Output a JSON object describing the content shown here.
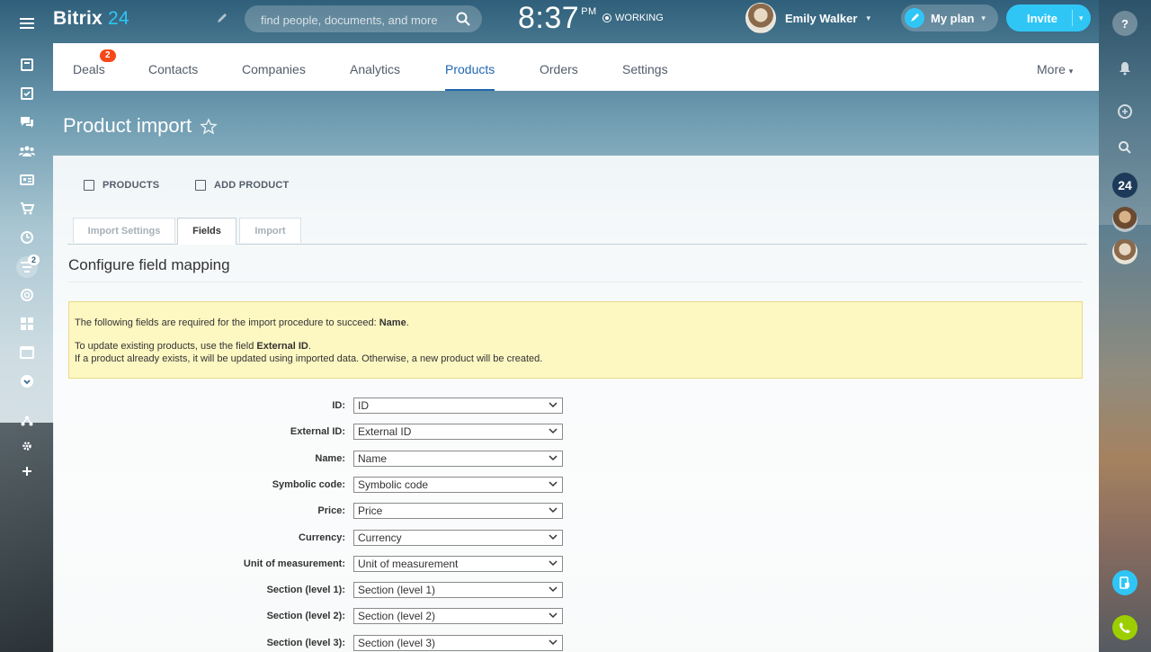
{
  "app": {
    "logo_text": "Bitrix",
    "logo_num": "24"
  },
  "header": {
    "search_placeholder": "find people, documents, and more",
    "time": "8:37",
    "ampm": "PM",
    "status": "WORKING",
    "user_name": "Emily Walker",
    "myplan_label": "My plan",
    "invite_label": "Invite"
  },
  "left_sidebar": {
    "badge": "2"
  },
  "nav": {
    "deals_badge": "2",
    "tabs": [
      {
        "label": "Deals"
      },
      {
        "label": "Contacts"
      },
      {
        "label": "Companies"
      },
      {
        "label": "Analytics"
      },
      {
        "label": "Products"
      },
      {
        "label": "Orders"
      },
      {
        "label": "Settings"
      }
    ],
    "more_label": "More"
  },
  "page": {
    "title": "Product import"
  },
  "toolbar": {
    "products_label": "PRODUCTS",
    "add_product_label": "ADD PRODUCT"
  },
  "import_tabs": [
    {
      "label": "Import Settings"
    },
    {
      "label": "Fields"
    },
    {
      "label": "Import"
    }
  ],
  "section": {
    "title": "Configure field mapping"
  },
  "notice": {
    "line1_prefix": "The following fields are required for the import procedure to succeed: ",
    "line1_bold": "Name",
    "line1_suffix": ".",
    "line2_prefix": "To update existing products, use the field ",
    "line2_bold": "External ID",
    "line2_suffix": ".",
    "line3": "If a product already exists, it will be updated using imported data. Otherwise, a new product will be created."
  },
  "right_bar": {
    "b24_label": "24"
  },
  "fields": [
    {
      "label": "ID:",
      "value": "ID"
    },
    {
      "label": "External ID:",
      "value": "External ID"
    },
    {
      "label": "Name:",
      "value": "Name"
    },
    {
      "label": "Symbolic code:",
      "value": "Symbolic code"
    },
    {
      "label": "Price:",
      "value": "Price"
    },
    {
      "label": "Currency:",
      "value": "Currency"
    },
    {
      "label": "Unit of measurement:",
      "value": "Unit of measurement"
    },
    {
      "label": "Section (level 1):",
      "value": "Section (level 1)"
    },
    {
      "label": "Section (level 2):",
      "value": "Section (level 2)"
    },
    {
      "label": "Section (level 3):",
      "value": "Section (level 3)"
    }
  ]
}
